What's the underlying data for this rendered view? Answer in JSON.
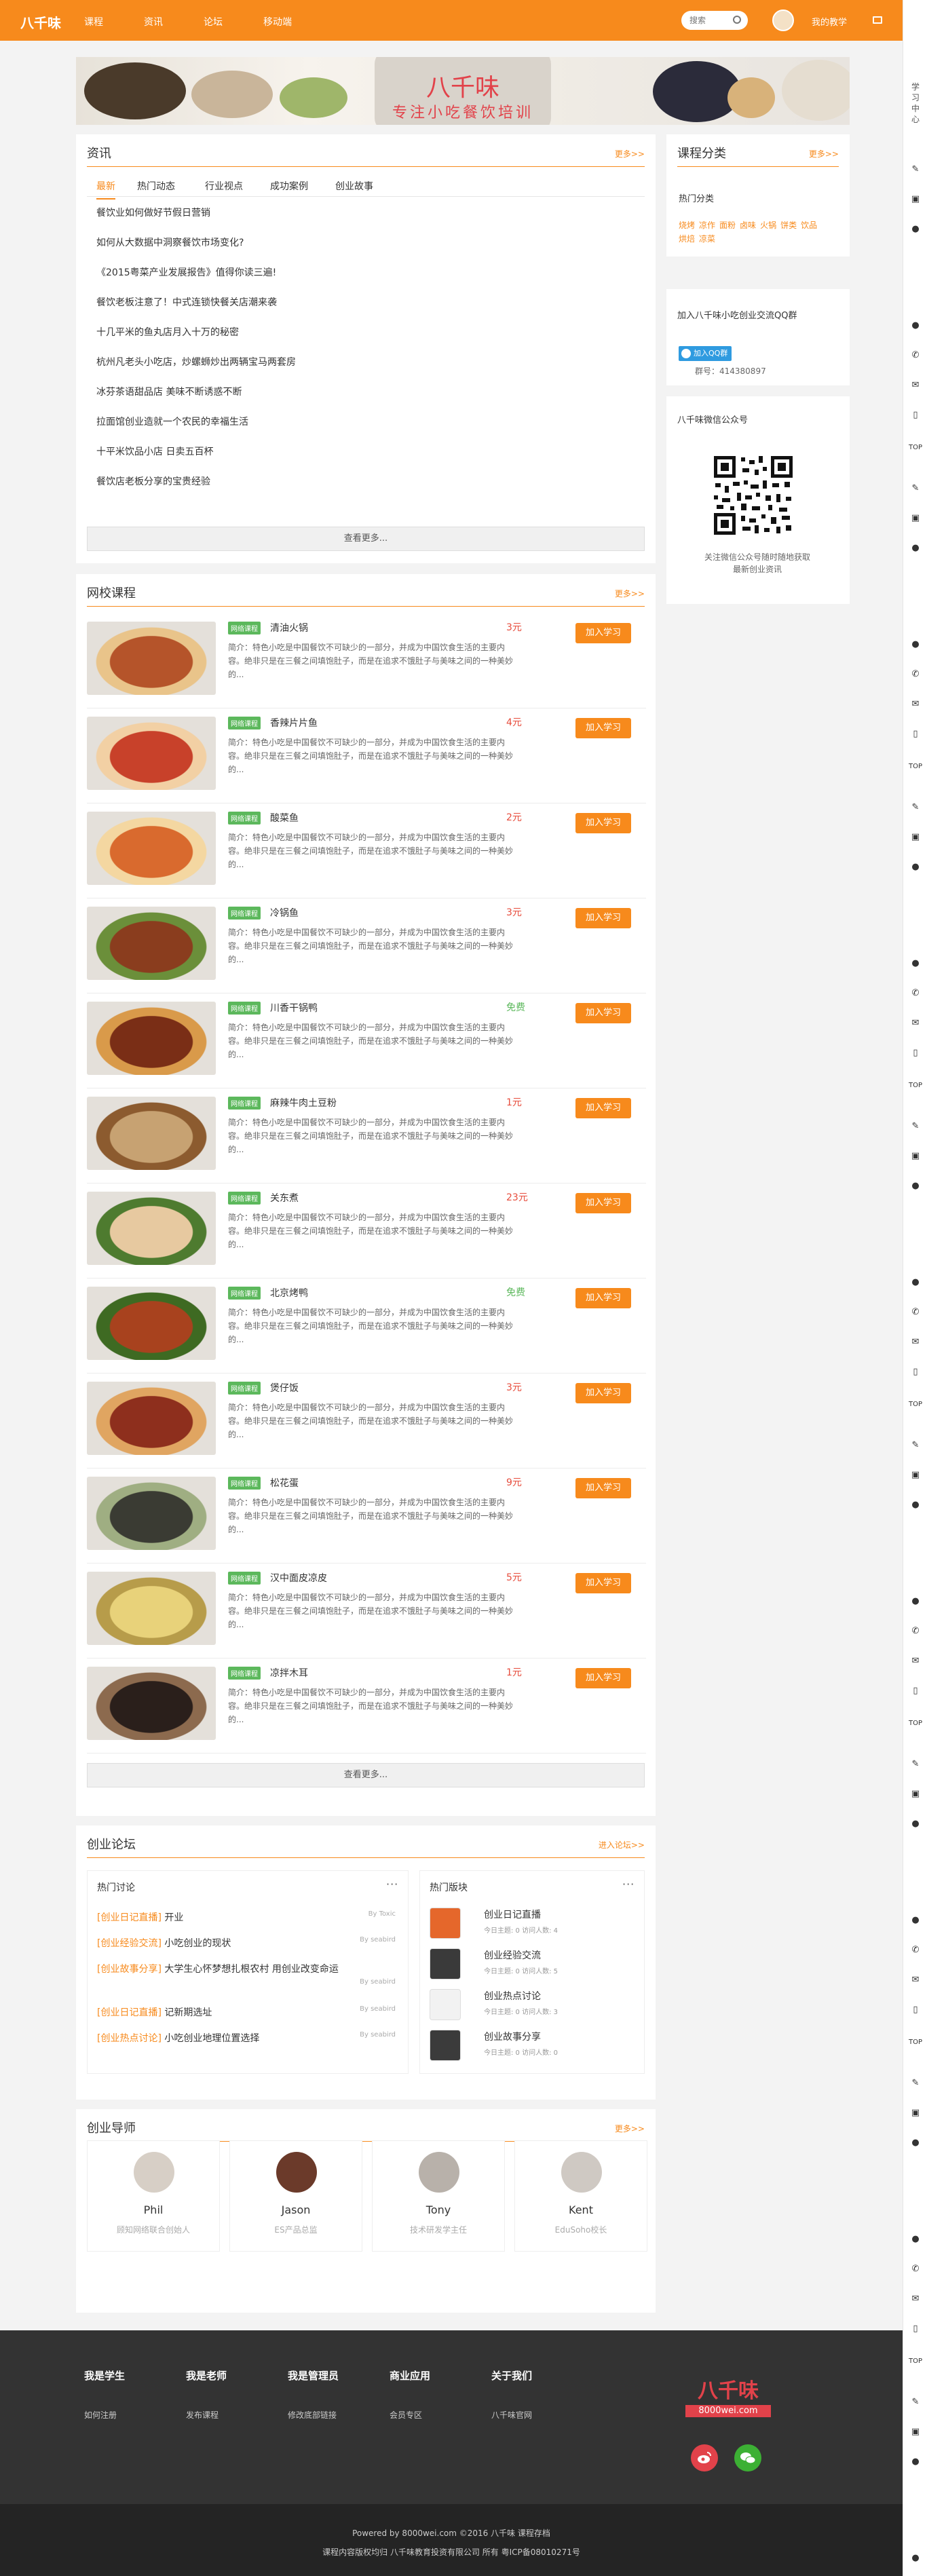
{
  "topnav": {
    "logo": "八千味",
    "items": [
      "课程",
      "资讯",
      "论坛",
      "移动端"
    ],
    "search_placeholder": "搜索",
    "my_learning": "我的教学"
  },
  "banner": {
    "title": "八千味",
    "subtitle": "专注小吃餐饮培训"
  },
  "news": {
    "title": "资讯",
    "more": "更多>>",
    "tabs": [
      "最新",
      "热门动态",
      "行业视点",
      "成功案例",
      "创业故事"
    ],
    "items": [
      "餐饮业如何做好节假日营销",
      "如何从大数据中洞察餐饮市场变化?",
      "《2015粤菜产业发展报告》值得你读三遍!",
      "餐饮老板注意了！中式连锁快餐关店潮来袭",
      "十几平米的鱼丸店月入十万的秘密",
      "杭州凡老头小吃店，炒螺蛳炒出两辆宝马两套房",
      "冰芬茶语甜品店 美味不断诱惑不断",
      "拉面馆创业造就一个农民的幸福生活",
      "十平米饮品小店 日卖五百杯",
      "餐饮店老板分享的宝贵经验"
    ],
    "view_more": "查看更多..."
  },
  "courses": {
    "title": "网校课程",
    "more": "更多>>",
    "tag": "网络课程",
    "join_label": "加入学习",
    "desc": "简介：特色小吃是中国餐饮不可缺少的一部分，并成为中国饮食生活的主要内容。绝非只是在三餐之间填饱肚子，而是在追求不饿肚子与美味之间的一种美妙的...",
    "items": [
      {
        "name": "清油火锅",
        "price": "3元",
        "free": false
      },
      {
        "name": "香辣片片鱼",
        "price": "4元",
        "free": false
      },
      {
        "name": "酸菜鱼",
        "price": "2元",
        "free": false
      },
      {
        "name": "冷锅鱼",
        "price": "3元",
        "free": false
      },
      {
        "name": "川香干锅鸭",
        "price": "免费",
        "free": true
      },
      {
        "name": "麻辣牛肉土豆粉",
        "price": "1元",
        "free": false
      },
      {
        "name": "关东煮",
        "price": "23元",
        "free": false
      },
      {
        "name": "北京烤鸭",
        "price": "免费",
        "free": true
      },
      {
        "name": "煲仔饭",
        "price": "3元",
        "free": false
      },
      {
        "name": "松花蛋",
        "price": "9元",
        "free": false
      },
      {
        "name": "汉中面皮凉皮",
        "price": "5元",
        "free": false
      },
      {
        "name": "凉拌木耳",
        "price": "1元",
        "free": false
      }
    ],
    "view_more": "查看更多..."
  },
  "forum": {
    "title": "创业论坛",
    "enter": "进入论坛>>",
    "hot_title": "热门讨论",
    "board_title": "热门版块",
    "topics": [
      {
        "cat": "[创业日记直播]",
        "text": "开业",
        "by": "By Toxic"
      },
      {
        "cat": "[创业经验交流]",
        "text": "小吃创业的现状",
        "by": "By seabird"
      },
      {
        "cat": "[创业故事分享]",
        "text": "大学生心怀梦想扎根农村 用创业改变命运",
        "by": "By seabird"
      },
      {
        "cat": "[创业日记直播]",
        "text": "记新期选址",
        "by": "By seabird"
      },
      {
        "cat": "[创业热点讨论]",
        "text": "小吃创业地理位置选择",
        "by": "By seabird"
      }
    ],
    "boards": [
      {
        "name": "创业日记直播",
        "stats": "今日主题: 0 访问人数: 4"
      },
      {
        "name": "创业经验交流",
        "stats": "今日主题: 0 访问人数: 5"
      },
      {
        "name": "创业热点讨论",
        "stats": "今日主题: 0 访问人数: 3"
      },
      {
        "name": "创业故事分享",
        "stats": "今日主题: 0 访问人数: 0"
      }
    ]
  },
  "mentors": {
    "title": "创业导师",
    "more": "更多>>",
    "items": [
      {
        "name": "Phil",
        "desc": "顾知网络联合创始人"
      },
      {
        "name": "Jason",
        "desc": "ES产品总监"
      },
      {
        "name": "Tony",
        "desc": "技术研发学主任"
      },
      {
        "name": "Kent",
        "desc": "EduSoho校长"
      }
    ]
  },
  "sidebar": {
    "category_title": "课程分类",
    "category_more": "更多>>",
    "hot_label": "热门分类",
    "categories": [
      "烧烤",
      "凉作",
      "面粉",
      "卤味",
      "火锅",
      "饼类",
      "饮品",
      "烘焙",
      "凉菜"
    ],
    "qq_title": "加入八千味小吃创业交流QQ群",
    "qq_button": "加入QQ群",
    "qq_number": "群号：414380897",
    "wechat_title": "八千味微信公众号",
    "wechat_desc": "关注微信公众号随时随地获取最新创业资讯"
  },
  "footer": {
    "cols": [
      {
        "title": "我是学生",
        "link": "如何注册"
      },
      {
        "title": "我是老师",
        "link": "发布课程"
      },
      {
        "title": "我是管理员",
        "link": "修改底部链接"
      },
      {
        "title": "商业应用",
        "link": "会员专区"
      },
      {
        "title": "关于我们",
        "link": "八千味官网"
      }
    ],
    "brand": "八千味",
    "brand_url": "8000wei.com",
    "powered": "Powered by 8000wei.com ©2016  八千味   课程存档",
    "copyright": "课程内容版权均归 八千味教育投资有限公司 所有   粤ICP备08010271号"
  },
  "rail": {
    "top": "TOP",
    "side_text": "学习中心"
  },
  "colors": {
    "accent": "#f78a1c",
    "green": "#5cb85c",
    "price": "#e74c3c"
  }
}
